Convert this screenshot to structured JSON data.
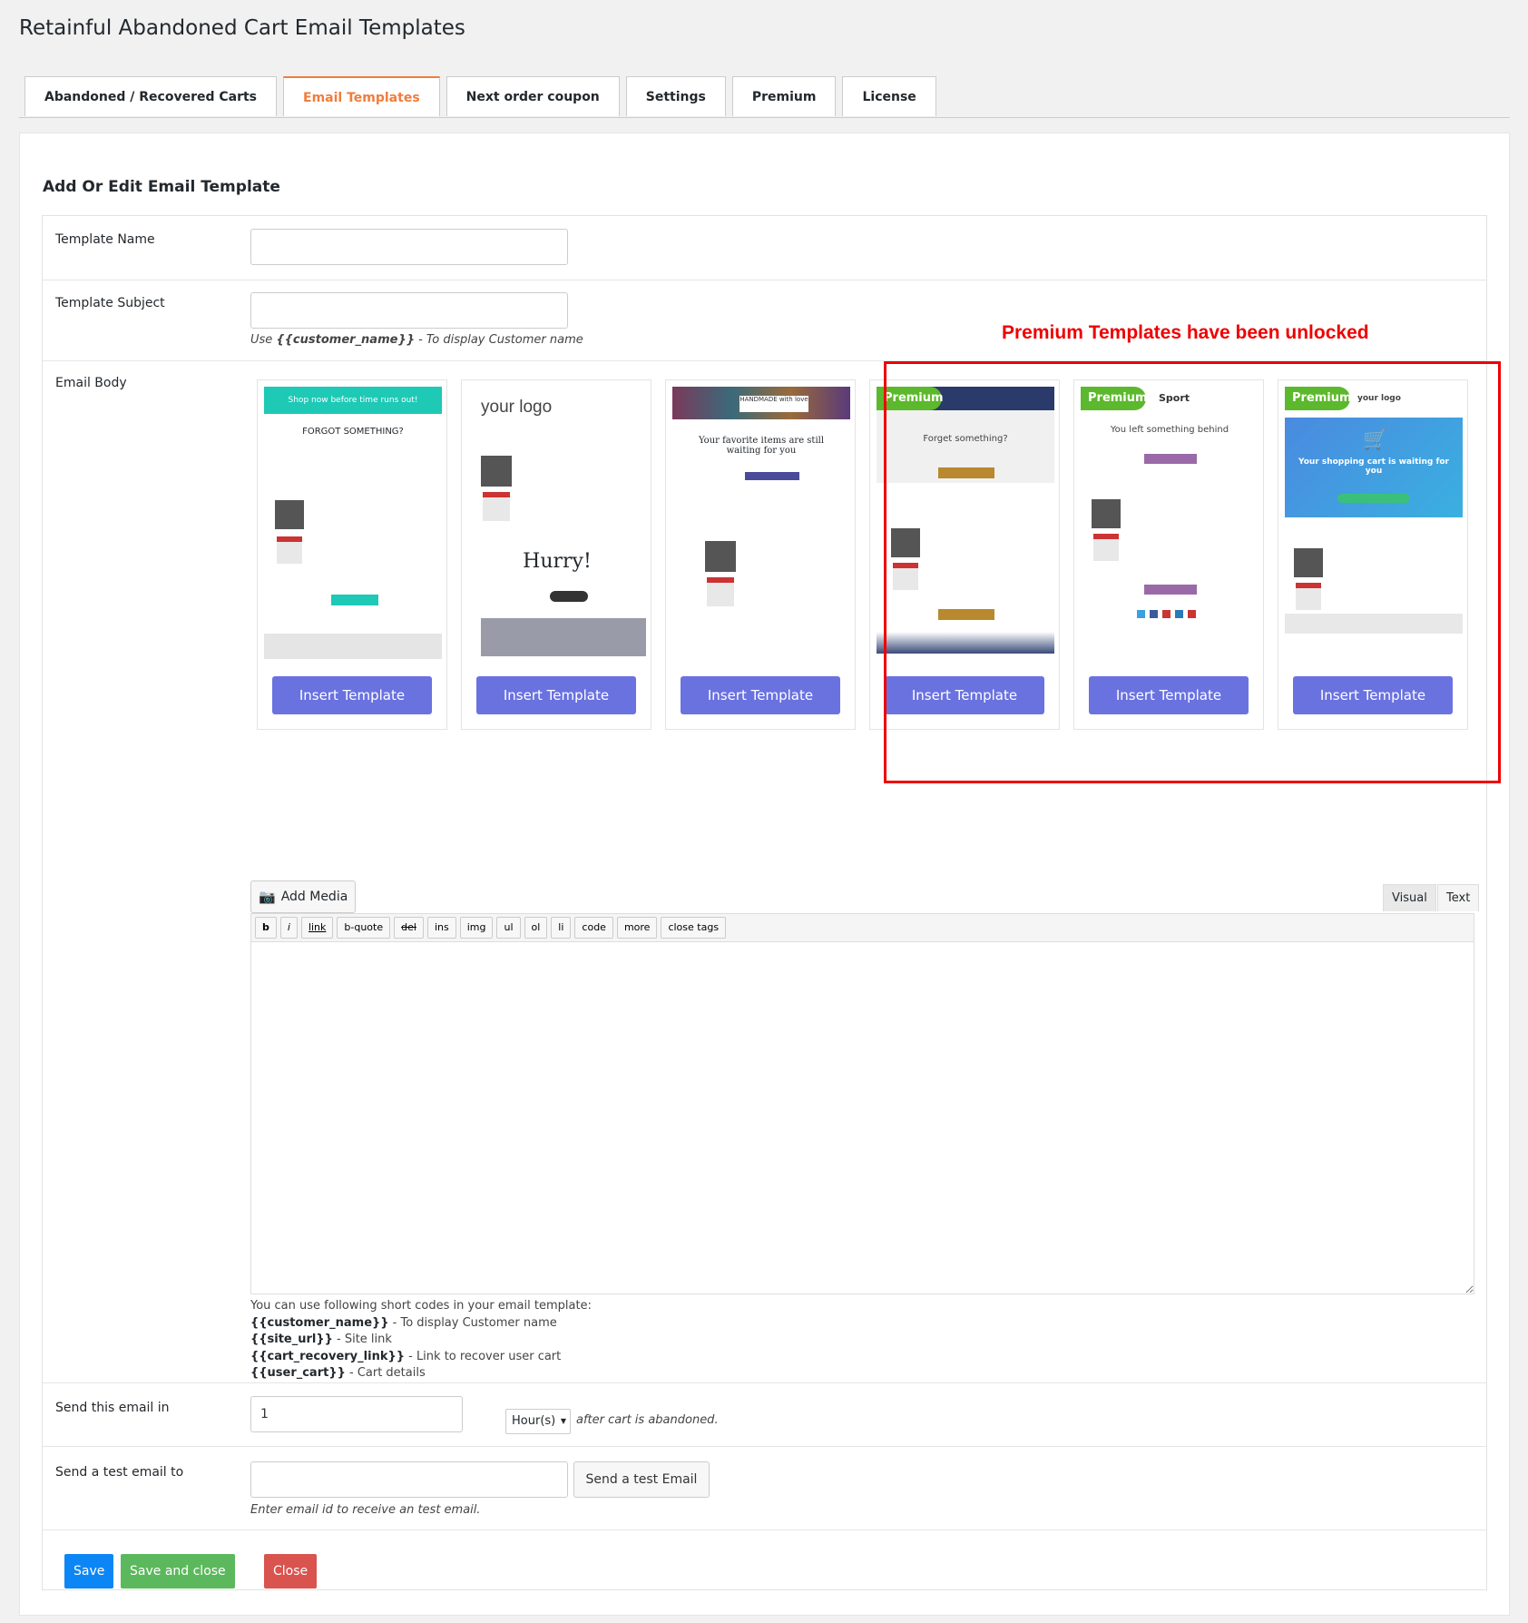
{
  "page_title": "Retainful Abandoned Cart Email Templates",
  "tabs": [
    {
      "label": "Abandoned / Recovered Carts",
      "active": false
    },
    {
      "label": "Email Templates",
      "active": true
    },
    {
      "label": "Next order coupon",
      "active": false
    },
    {
      "label": "Settings",
      "active": false
    },
    {
      "label": "Premium",
      "active": false
    },
    {
      "label": "License",
      "active": false
    }
  ],
  "section_title": "Add Or Edit Email Template",
  "fields": {
    "template_name_label": "Template Name",
    "template_name_value": "",
    "template_subject_label": "Template Subject",
    "template_subject_value": "",
    "subject_hint_prefix": "Use ",
    "subject_hint_code": "{{customer_name}}",
    "subject_hint_suffix": " - To display Customer name",
    "email_body_label": "Email Body"
  },
  "premium_note": "Premium Templates have been unlocked",
  "templates": [
    {
      "premium": false,
      "headline": "Shop now before time runs out!",
      "sub": "FORGOT SOMETHING?",
      "insert_label": "Insert Template"
    },
    {
      "premium": false,
      "headline": "your logo",
      "sub": "Hurry!",
      "insert_label": "Insert Template"
    },
    {
      "premium": false,
      "headline": "HANDMADE with love",
      "sub": "Your favorite items are still waiting for you",
      "insert_label": "Insert Template"
    },
    {
      "premium": true,
      "badge": "Premium",
      "sub": "Forget something?",
      "insert_label": "Insert Template"
    },
    {
      "premium": true,
      "badge": "Premium",
      "headline": "Sport",
      "sub": "You left something behind",
      "insert_label": "Insert Template"
    },
    {
      "premium": true,
      "badge": "Premium",
      "headline": "your logo",
      "sub": "Your shopping cart is waiting for you",
      "insert_label": "Insert Template"
    }
  ],
  "editor": {
    "add_media": "Add Media",
    "visual_tab": "Visual",
    "text_tab": "Text",
    "quicktags": [
      "b",
      "i",
      "link",
      "b-quote",
      "del",
      "ins",
      "img",
      "ul",
      "ol",
      "li",
      "code",
      "more",
      "close tags"
    ],
    "content": ""
  },
  "shortcodes": {
    "intro": "You can use following short codes in your email template:",
    "items": [
      {
        "code": "{{customer_name}}",
        "desc": " - To display Customer name"
      },
      {
        "code": "{{site_url}}",
        "desc": " - Site link"
      },
      {
        "code": "{{cart_recovery_link}}",
        "desc": " - Link to recover user cart"
      },
      {
        "code": "{{user_cart}}",
        "desc": " - Cart details"
      }
    ]
  },
  "send_in": {
    "label": "Send this email in",
    "value": "1",
    "unit": "Hour(s)",
    "suffix": "after cart is abandoned."
  },
  "test_email": {
    "label": "Send a test email to",
    "value": "",
    "button": "Send a test Email",
    "hint": "Enter email id to receive an test email."
  },
  "actions": {
    "save": "Save",
    "save_close": "Save and close",
    "close": "Close"
  },
  "colors": {
    "accent": "#6a72e0",
    "tab_active": "#f07d3c",
    "save": "#0d86f5",
    "save_close": "#5cb85c",
    "close": "#d9534f",
    "premium_badge": "#5cb82c",
    "highlight": "#ee0000"
  }
}
